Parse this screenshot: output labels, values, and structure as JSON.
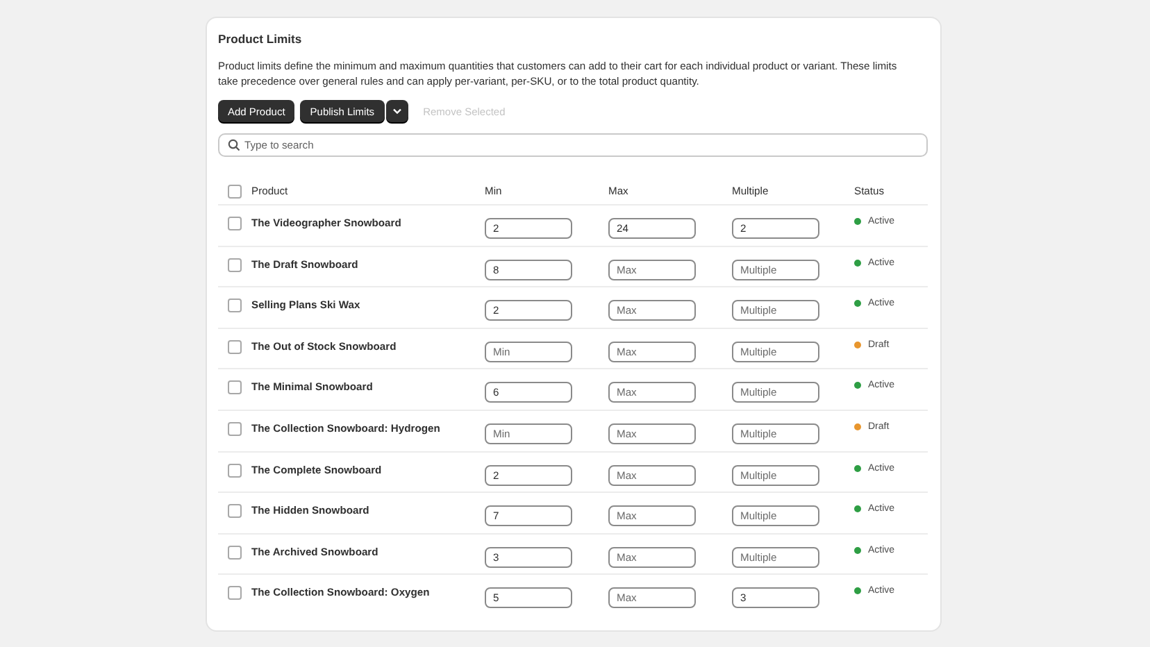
{
  "card": {
    "title": "Product Limits",
    "description": "Product limits define the minimum and maximum quantities that customers can add to their cart for each individual product or variant. These limits take precedence over general rules and can apply per-variant, per-SKU, or to the total product quantity."
  },
  "actions": [
    {
      "label": "Add Product",
      "kind": "primary"
    },
    {
      "label": "Publish Limits",
      "kind": "split"
    },
    {
      "label": "Remove Selected",
      "kind": "plain",
      "disabled": true
    }
  ],
  "search": {
    "placeholder": "Type to search"
  },
  "table": {
    "select_all_checked": false,
    "columns": [
      "Product",
      "Min",
      "Max",
      "Multiple",
      "Status"
    ],
    "rows": [
      {
        "checked": false,
        "product": "The Videographer Snowboard",
        "min": {
          "value": "2"
        },
        "max": {
          "value": "24"
        },
        "multiple": {
          "value": "2"
        },
        "status": "Active",
        "color": "#2e9e44"
      },
      {
        "checked": false,
        "product": "The Draft Snowboard",
        "min": {
          "value": "8"
        },
        "max": {
          "placeholder": "Max"
        },
        "multiple": {
          "placeholder": "Multiple"
        },
        "status": "Active",
        "color": "#2e9e44"
      },
      {
        "checked": false,
        "product": "Selling Plans Ski Wax",
        "min": {
          "value": "2"
        },
        "max": {
          "placeholder": "Max"
        },
        "multiple": {
          "placeholder": "Multiple"
        },
        "status": "Active",
        "color": "#2e9e44"
      },
      {
        "checked": false,
        "product": "The Out of Stock Snowboard",
        "min": {
          "placeholder": "Min"
        },
        "max": {
          "placeholder": "Max"
        },
        "multiple": {
          "placeholder": "Multiple"
        },
        "status": "Draft",
        "color": "#e8962e"
      },
      {
        "checked": false,
        "product": "The Minimal Snowboard",
        "min": {
          "value": "6"
        },
        "max": {
          "placeholder": "Max"
        },
        "multiple": {
          "placeholder": "Multiple"
        },
        "status": "Active",
        "color": "#2e9e44"
      },
      {
        "checked": false,
        "product": "The Collection Snowboard: Hydrogen",
        "min": {
          "placeholder": "Min"
        },
        "max": {
          "placeholder": "Max"
        },
        "multiple": {
          "placeholder": "Multiple"
        },
        "status": "Draft",
        "color": "#e8962e"
      },
      {
        "checked": false,
        "product": "The Complete Snowboard",
        "min": {
          "value": "2"
        },
        "max": {
          "placeholder": "Max"
        },
        "multiple": {
          "placeholder": "Multiple"
        },
        "status": "Active",
        "color": "#2e9e44"
      },
      {
        "checked": false,
        "product": "The Hidden Snowboard",
        "min": {
          "value": "7"
        },
        "max": {
          "placeholder": "Max"
        },
        "multiple": {
          "placeholder": "Multiple"
        },
        "status": "Active",
        "color": "#2e9e44"
      },
      {
        "checked": false,
        "product": "The Archived Snowboard",
        "min": {
          "value": "3"
        },
        "max": {
          "placeholder": "Max"
        },
        "multiple": {
          "placeholder": "Multiple"
        },
        "status": "Active",
        "color": "#2e9e44"
      },
      {
        "checked": false,
        "product": "The Collection Snowboard: Oxygen",
        "min": {
          "value": "5"
        },
        "max": {
          "placeholder": "Max"
        },
        "multiple": {
          "value": "3"
        },
        "status": "Active",
        "color": "#2e9e44"
      }
    ]
  }
}
